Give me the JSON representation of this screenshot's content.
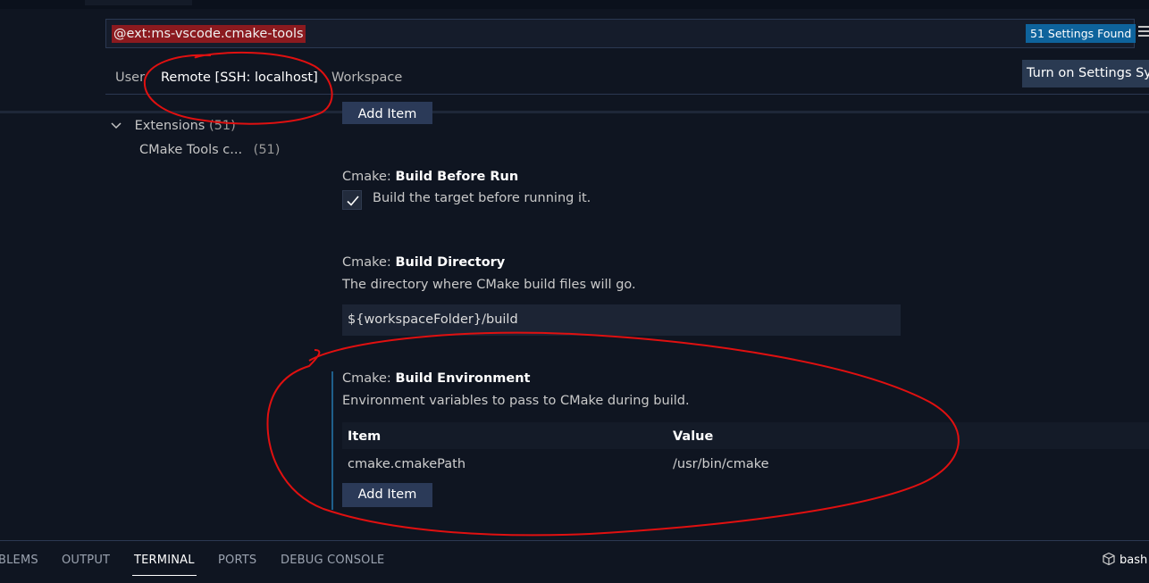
{
  "search": {
    "query": "@ext:ms-vscode.cmake-tools",
    "results_badge": "51 Settings Found"
  },
  "scope_tabs": [
    {
      "label": "User"
    },
    {
      "label": "Remote [SSH: localhost]"
    },
    {
      "label": "Workspace"
    }
  ],
  "sync_button": "Turn on Settings Sy",
  "toc": {
    "group_label": "Extensions",
    "group_count": "(51)",
    "item_label": "CMake Tools c...",
    "item_count": "(51)"
  },
  "add_item_label": "Add Item",
  "settings": {
    "build_before_run": {
      "category": "Cmake: ",
      "name": "Build Before Run",
      "checkbox_label": "Build the target before running it.",
      "checked": true
    },
    "build_directory": {
      "category": "Cmake: ",
      "name": "Build Directory",
      "description": "The directory where CMake build files will go.",
      "value": "${workspaceFolder}/build"
    },
    "build_environment": {
      "category": "Cmake: ",
      "name": "Build Environment",
      "description": "Environment variables to pass to CMake during build.",
      "columns": {
        "item": "Item",
        "value": "Value"
      },
      "rows": [
        {
          "item": "cmake.cmakePath",
          "value": "/usr/bin/cmake"
        }
      ]
    }
  },
  "panel": {
    "tabs": [
      {
        "label": "BLEMS"
      },
      {
        "label": "OUTPUT"
      },
      {
        "label": "TERMINAL"
      },
      {
        "label": "PORTS"
      },
      {
        "label": "DEBUG CONSOLE"
      }
    ],
    "terminal_label": "bash"
  },
  "colors": {
    "background": "#0f1521",
    "accent": "#0e639c",
    "button": "#2b3a58",
    "annotation": "#e01010",
    "search_highlight": "#8b1a1f"
  }
}
